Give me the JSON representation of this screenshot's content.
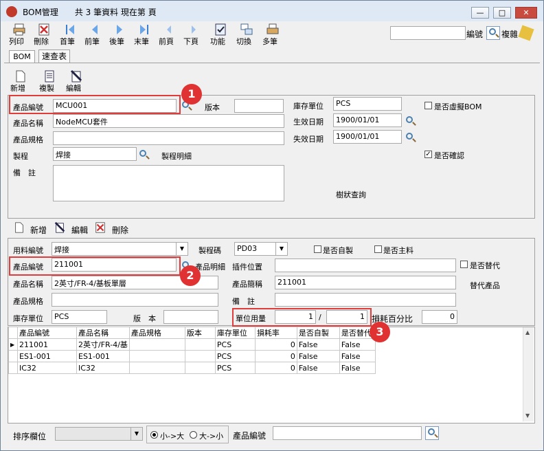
{
  "window": {
    "title": "BOM管理",
    "record_info": "共 3 筆資料  現在第 頁",
    "min": "—",
    "max": "□",
    "close": "✕"
  },
  "toolbar": {
    "print": "列印",
    "delete": "刪除",
    "first": "首筆",
    "prev": "前筆",
    "next": "後筆",
    "last": "末筆",
    "prev_page": "前頁",
    "next_page": "下頁",
    "function": "功能",
    "switch": "切換",
    "multi": "多筆",
    "code_label": "編號",
    "complex": "複雜",
    "search_value": ""
  },
  "tabs": [
    "BOM",
    "速查表"
  ],
  "bom_actions": {
    "add": "新增",
    "copy": "複製",
    "edit": "編輯"
  },
  "header": {
    "product_code_label": "產品編號",
    "product_code": "MCU001",
    "version_label": "版本",
    "version": "",
    "unit_label": "庫存單位",
    "unit": "PCS",
    "virtual_label": "是否虛擬BOM",
    "virtual": false,
    "name_label": "產品名稱",
    "name": "NodeMCU套件",
    "effective_label": "生效日期",
    "effective": "1900/01/01",
    "spec_label": "產品規格",
    "spec": "",
    "expire_label": "失效日期",
    "expire": "1900/01/01",
    "process_label": "製程",
    "process": "焊接",
    "process_detail": "製程明細",
    "confirmed_label": "是否確認",
    "confirmed": true,
    "remark_label": "備　註",
    "remark": "",
    "tree_query": "樹狀查詢"
  },
  "detail_actions": {
    "add": "新增",
    "edit": "編輯",
    "delete": "刪除"
  },
  "detail": {
    "material_label": "用料編號",
    "material": "焊接",
    "process_code_label": "製程碼",
    "process_code": "PD03",
    "self_made_label": "是否自製",
    "main_material_label": "是否主料",
    "product_code_label": "產品編號",
    "product_code": "211001",
    "product_detail": "產品明細",
    "slot_label": "插件位置",
    "slot": "",
    "substitute_label": "是否替代",
    "name_label": "產品名稱",
    "name": "2英寸/FR-4/基板單層",
    "short_label": "產品簡稱",
    "short": "211001",
    "substitute_products": "替代產品",
    "spec_label": "產品規格",
    "spec": "",
    "remark_label": "備　註",
    "remark": "",
    "unit_label": "庫存單位",
    "unit": "PCS",
    "version_label": "版　本",
    "version": "",
    "usage_label": "單位用量",
    "usage_num": "1",
    "usage_slash": "/",
    "usage_den": "1",
    "loss_label": "損耗百分比",
    "loss": "0"
  },
  "table": {
    "columns": [
      "產品編號",
      "產品名稱",
      "產品規格",
      "版本",
      "庫存單位",
      "損耗率",
      "是否自製",
      "是否替代"
    ],
    "rows": [
      [
        "211001",
        "2英寸/FR-4/基",
        "",
        "",
        "PCS",
        "0",
        "False",
        "False"
      ],
      [
        "ES1-001",
        "ES1-001",
        "",
        "",
        "PCS",
        "0",
        "False",
        "False"
      ],
      [
        "IC32",
        "IC32",
        "",
        "",
        "PCS",
        "0",
        "False",
        "False"
      ]
    ]
  },
  "footer": {
    "sort_label": "排序欄位",
    "sort_value": "",
    "asc": "小->大",
    "desc": "大->小",
    "code_label": "產品編號",
    "code_value": ""
  },
  "annotations": [
    "1",
    "2",
    "3"
  ]
}
